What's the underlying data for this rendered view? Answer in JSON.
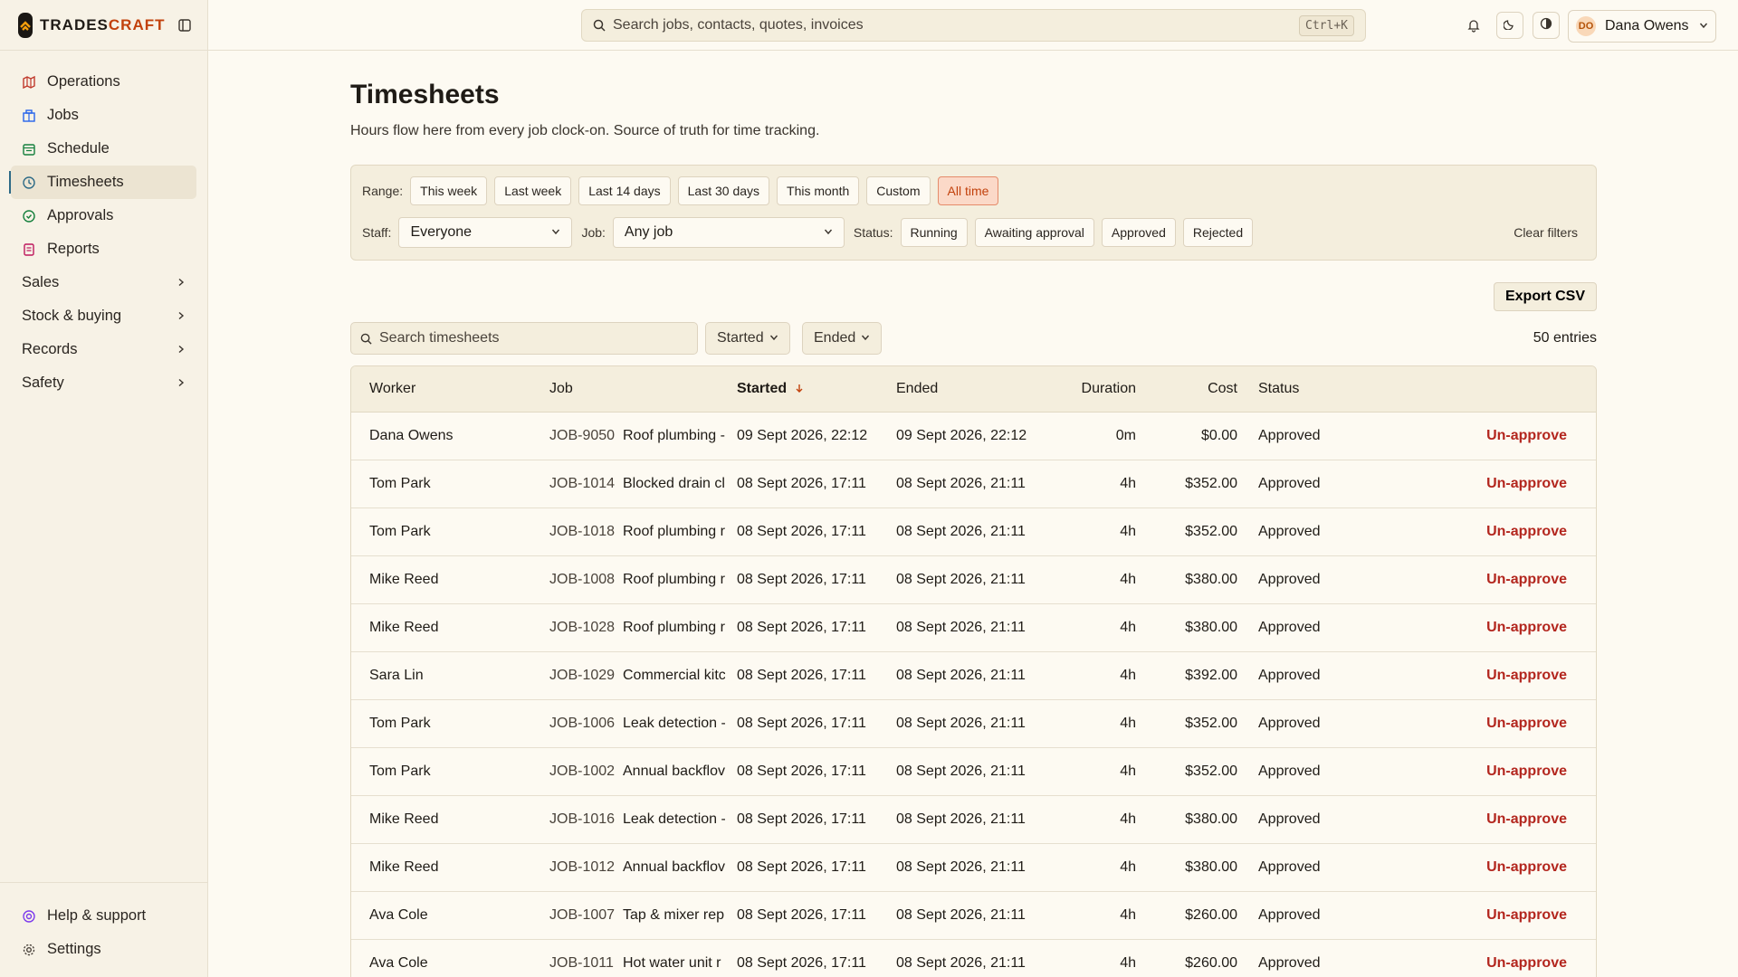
{
  "brand": {
    "name_part1": "TRADES",
    "name_part2": "CRAFT"
  },
  "sidebar": {
    "items": [
      {
        "label": "Operations",
        "icon": "map-icon",
        "color": "#c0392b"
      },
      {
        "label": "Jobs",
        "icon": "building-icon",
        "color": "#2563eb"
      },
      {
        "label": "Schedule",
        "icon": "calendar-icon",
        "color": "#15803d"
      },
      {
        "label": "Timesheets",
        "icon": "clock-icon",
        "color": "#2d6a86",
        "active": true
      },
      {
        "label": "Approvals",
        "icon": "check-circle-icon",
        "color": "#15803d"
      },
      {
        "label": "Reports",
        "icon": "report-icon",
        "color": "#be185d"
      }
    ],
    "groups": [
      {
        "label": "Sales"
      },
      {
        "label": "Stock & buying"
      },
      {
        "label": "Records"
      },
      {
        "label": "Safety"
      }
    ],
    "footer": [
      {
        "label": "Help & support",
        "icon": "help-icon"
      },
      {
        "label": "Settings",
        "icon": "gear-icon"
      }
    ]
  },
  "topbar": {
    "search_placeholder": "Search jobs, contacts, quotes, invoices",
    "shortcut": "Ctrl+K",
    "user": {
      "initials": "DO",
      "name": "Dana Owens"
    }
  },
  "page": {
    "title": "Timesheets",
    "subtitle": "Hours flow here from every job clock-on. Source of truth for time tracking."
  },
  "filters": {
    "range_label": "Range:",
    "ranges": [
      "This week",
      "Last week",
      "Last 14 days",
      "Last 30 days",
      "This month",
      "Custom",
      "All time"
    ],
    "active_range": "All time",
    "staff_label": "Staff:",
    "staff_value": "Everyone",
    "job_label": "Job:",
    "job_value": "Any job",
    "status_label": "Status:",
    "statuses": [
      "Running",
      "Awaiting approval",
      "Approved",
      "Rejected"
    ],
    "clear": "Clear filters"
  },
  "toolbar": {
    "export": "Export CSV",
    "search_placeholder": "Search timesheets",
    "sort_started": "Started",
    "sort_ended": "Ended",
    "entries": "50 entries"
  },
  "table": {
    "headers": {
      "worker": "Worker",
      "job": "Job",
      "started": "Started",
      "ended": "Ended",
      "duration": "Duration",
      "cost": "Cost",
      "status": "Status"
    },
    "rows": [
      {
        "worker": "Dana Owens",
        "job_id": "JOB-9050",
        "job_name": "Roof plumbing -",
        "started": "09 Sept 2026, 22:12",
        "ended": "09 Sept 2026, 22:12",
        "duration": "0m",
        "cost": "$0.00",
        "status": "Approved",
        "action": "Un-approve"
      },
      {
        "worker": "Tom Park",
        "job_id": "JOB-1014",
        "job_name": "Blocked drain cl",
        "started": "08 Sept 2026, 17:11",
        "ended": "08 Sept 2026, 21:11",
        "duration": "4h",
        "cost": "$352.00",
        "status": "Approved",
        "action": "Un-approve"
      },
      {
        "worker": "Tom Park",
        "job_id": "JOB-1018",
        "job_name": "Roof plumbing r",
        "started": "08 Sept 2026, 17:11",
        "ended": "08 Sept 2026, 21:11",
        "duration": "4h",
        "cost": "$352.00",
        "status": "Approved",
        "action": "Un-approve"
      },
      {
        "worker": "Mike Reed",
        "job_id": "JOB-1008",
        "job_name": "Roof plumbing r",
        "started": "08 Sept 2026, 17:11",
        "ended": "08 Sept 2026, 21:11",
        "duration": "4h",
        "cost": "$380.00",
        "status": "Approved",
        "action": "Un-approve"
      },
      {
        "worker": "Mike Reed",
        "job_id": "JOB-1028",
        "job_name": "Roof plumbing r",
        "started": "08 Sept 2026, 17:11",
        "ended": "08 Sept 2026, 21:11",
        "duration": "4h",
        "cost": "$380.00",
        "status": "Approved",
        "action": "Un-approve"
      },
      {
        "worker": "Sara Lin",
        "job_id": "JOB-1029",
        "job_name": "Commercial kitc",
        "started": "08 Sept 2026, 17:11",
        "ended": "08 Sept 2026, 21:11",
        "duration": "4h",
        "cost": "$392.00",
        "status": "Approved",
        "action": "Un-approve"
      },
      {
        "worker": "Tom Park",
        "job_id": "JOB-1006",
        "job_name": "Leak detection -",
        "started": "08 Sept 2026, 17:11",
        "ended": "08 Sept 2026, 21:11",
        "duration": "4h",
        "cost": "$352.00",
        "status": "Approved",
        "action": "Un-approve"
      },
      {
        "worker": "Tom Park",
        "job_id": "JOB-1002",
        "job_name": "Annual backflov",
        "started": "08 Sept 2026, 17:11",
        "ended": "08 Sept 2026, 21:11",
        "duration": "4h",
        "cost": "$352.00",
        "status": "Approved",
        "action": "Un-approve"
      },
      {
        "worker": "Mike Reed",
        "job_id": "JOB-1016",
        "job_name": "Leak detection -",
        "started": "08 Sept 2026, 17:11",
        "ended": "08 Sept 2026, 21:11",
        "duration": "4h",
        "cost": "$380.00",
        "status": "Approved",
        "action": "Un-approve"
      },
      {
        "worker": "Mike Reed",
        "job_id": "JOB-1012",
        "job_name": "Annual backflov",
        "started": "08 Sept 2026, 17:11",
        "ended": "08 Sept 2026, 21:11",
        "duration": "4h",
        "cost": "$380.00",
        "status": "Approved",
        "action": "Un-approve"
      },
      {
        "worker": "Ava Cole",
        "job_id": "JOB-1007",
        "job_name": "Tap & mixer rep",
        "started": "08 Sept 2026, 17:11",
        "ended": "08 Sept 2026, 21:11",
        "duration": "4h",
        "cost": "$260.00",
        "status": "Approved",
        "action": "Un-approve"
      },
      {
        "worker": "Ava Cole",
        "job_id": "JOB-1011",
        "job_name": "Hot water unit r",
        "started": "08 Sept 2026, 17:11",
        "ended": "08 Sept 2026, 21:11",
        "duration": "4h",
        "cost": "$260.00",
        "status": "Approved",
        "action": "Un-approve"
      }
    ]
  }
}
